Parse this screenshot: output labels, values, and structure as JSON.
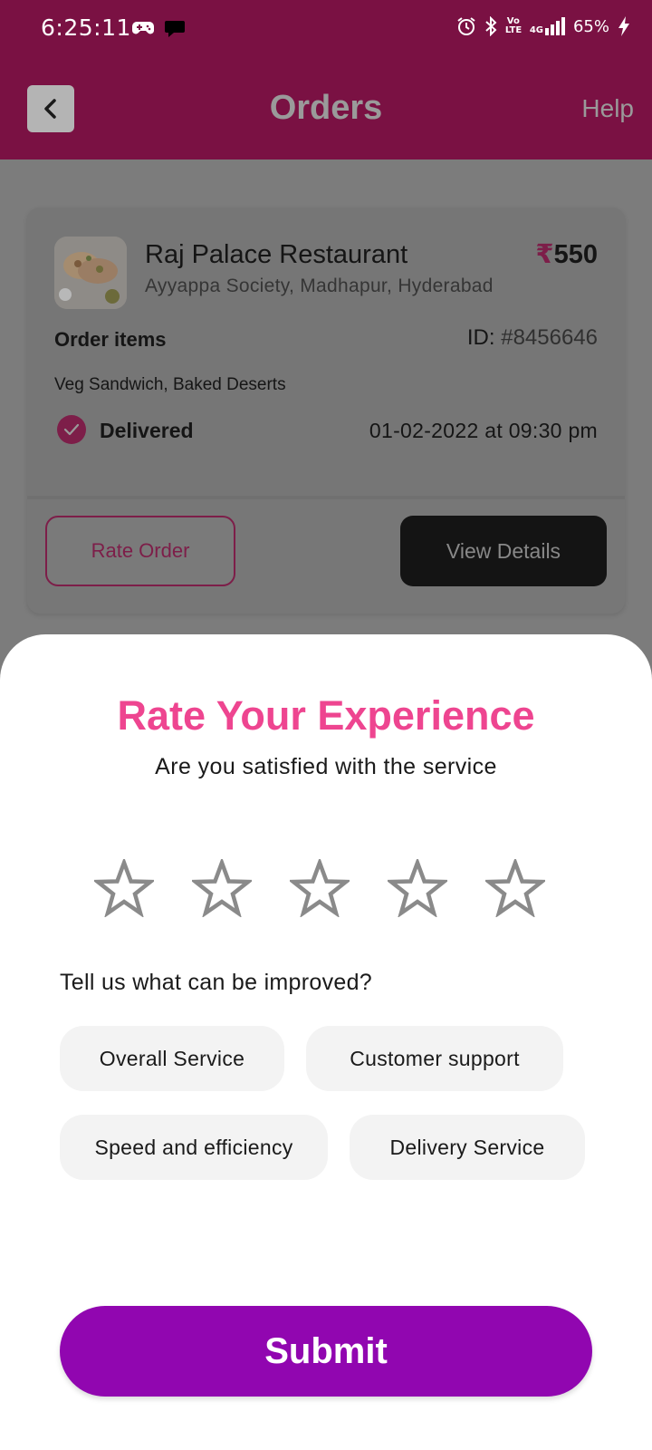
{
  "status_bar": {
    "time": "6:25:11",
    "volte_label": "Vo LTE",
    "network_label": "4G",
    "battery": "65%"
  },
  "header": {
    "title": "Orders",
    "help": "Help"
  },
  "order": {
    "restaurant_name": "Raj Palace Restaurant",
    "address": "Ayyappa Society, Madhapur, Hyderabad",
    "currency_symbol": "₹",
    "price": "550",
    "items_label": "Order items",
    "id_label": "ID:",
    "id_value": "#8456646",
    "items": "Veg Sandwich, Baked Deserts",
    "status": "Delivered",
    "date": "01-02-2022 at 09:30 pm",
    "rate_button": "Rate Order",
    "details_button": "View Details"
  },
  "sheet": {
    "title": "Rate Your Experience",
    "subtitle": "Are you satisfied with the service",
    "rating": 0,
    "max_rating": 5,
    "improve_label": "Tell us what can be improved?",
    "chips": [
      "Overall Service",
      "Customer support",
      "Speed and efficiency",
      "Delivery Service"
    ],
    "submit": "Submit"
  },
  "colors": {
    "brand_header": "#7a1143",
    "accent_pink": "#ee4590",
    "submit_purple": "#9106b0",
    "chip_bg": "#f3f3f3",
    "star_outline": "#8a8a8a"
  },
  "icons": {
    "back": "chevron-left-icon",
    "status_check": "check-circle-icon",
    "star": "star-outline-icon"
  }
}
